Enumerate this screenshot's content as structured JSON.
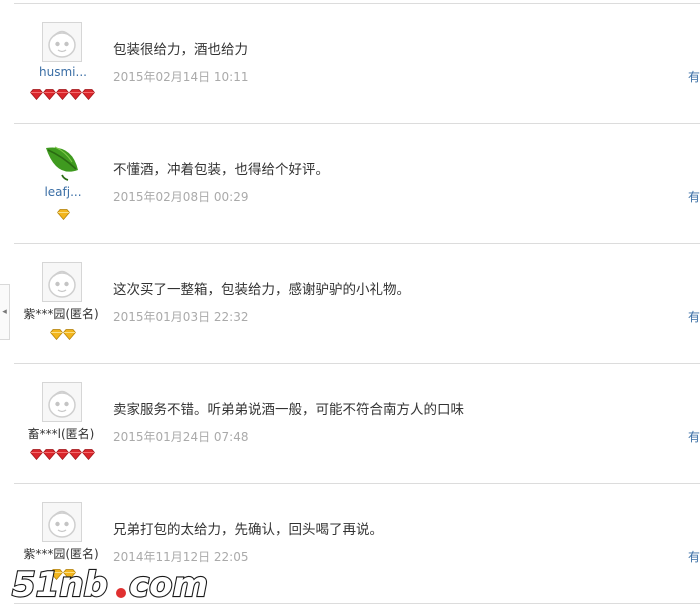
{
  "reviews": [
    {
      "nick": "husmi...",
      "avatar": "default-face-icon",
      "level_icon": "ruby",
      "level_count": 5,
      "comment": "包装很给力，酒也给力",
      "date": "2015年02月14日 10:11",
      "action": "有用"
    },
    {
      "nick": "leafj...",
      "avatar": "green-leaf-icon",
      "level_icon": "gold-diamond",
      "level_count": 1,
      "comment": "不懂酒，冲着包装，也得给个好评。",
      "date": "2015年02月08日 00:29",
      "action": "有用"
    },
    {
      "nick": "紫***园(匿名)",
      "avatar": "default-face-icon",
      "level_icon": "gold-diamond",
      "level_count": 2,
      "comment": "这次买了一整箱，包装给力，感谢驴驴的小礼物。",
      "date": "2015年01月03日 22:32",
      "action": "有用"
    },
    {
      "nick": "畜***l(匿名)",
      "avatar": "default-face-icon",
      "level_icon": "ruby",
      "level_count": 5,
      "comment": "卖家服务不错。听弟弟说酒一般，可能不符合南方人的口味",
      "date": "2015年01月24日 07:48",
      "action": "有用"
    },
    {
      "nick": "紫***园(匿名)",
      "avatar": "default-face-icon",
      "level_icon": "gold-diamond",
      "level_count": 2,
      "comment": "兄弟打包的太给力，先确认，回头喝了再说。",
      "date": "2014年11月12日 22:05",
      "action": "有用"
    }
  ],
  "side_tab": {
    "arrow": "◂"
  },
  "watermark": {
    "text": "51nb.com",
    "accent": "#e03030"
  },
  "colors": {
    "link": "#3a6ea5",
    "date": "#aaaaaa",
    "ruby": "#d9262b",
    "gold": "#f2b51d",
    "divider": "#dcdcdc"
  }
}
